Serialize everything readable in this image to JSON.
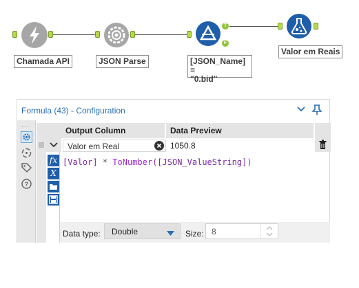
{
  "workflow": {
    "tools": [
      {
        "label": "Chamada API"
      },
      {
        "label": "JSON Parse"
      },
      {
        "label": "[JSON_Name] =\n\"0.bid\""
      },
      {
        "label": "Valor em Reais"
      }
    ],
    "filter_anchors": {
      "true": "T",
      "false": "F"
    }
  },
  "panel": {
    "title": "Formula (43) - Configuration",
    "columns": {
      "output": "Output Column",
      "preview": "Data Preview"
    },
    "row": {
      "output_value": "Valor em Real",
      "preview_value": "1050.8"
    },
    "expression": {
      "part1": "[Valor]",
      "op": " * ",
      "fn": "ToNumber(",
      "field": "[JSON_ValueString]",
      "close": ")"
    },
    "data_type_label": "Data type:",
    "data_type_value": "Double",
    "size_label": "Size:",
    "size_value": "8"
  },
  "icons": {
    "sidebar": [
      "gear-icon",
      "circular-arrows-icon",
      "tag-icon",
      "help-icon"
    ],
    "side_buttons": [
      "fx",
      "X",
      "folder",
      "save"
    ],
    "fx_text": "fx",
    "x_text": "X"
  }
}
